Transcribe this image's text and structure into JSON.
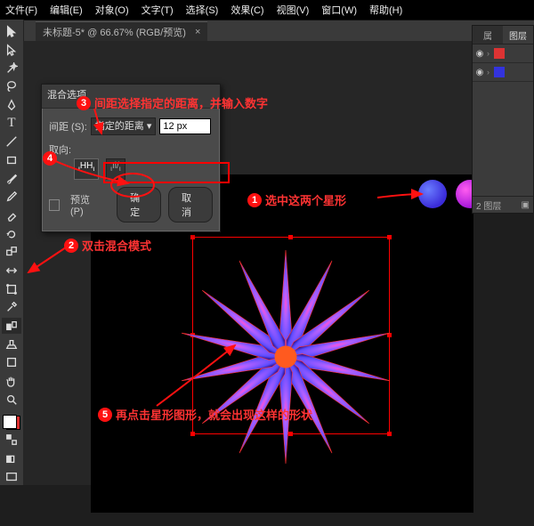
{
  "menu": [
    "文件(F)",
    "编辑(E)",
    "对象(O)",
    "文字(T)",
    "选择(S)",
    "效果(C)",
    "视图(V)",
    "窗口(W)",
    "帮助(H)"
  ],
  "tab": {
    "title": "未标题-5* @ 66.67% (RGB/预览)",
    "close": "×"
  },
  "dialog": {
    "title": "混合选项",
    "spacing_label": "间距 (S):",
    "spacing_mode": "指定的距离",
    "spacing_value": "12 px",
    "orient_label": "取向:",
    "preview": "预览 (P)",
    "ok": "确定",
    "cancel": "取消"
  },
  "annotations": {
    "a1": "选中这两个星形",
    "a2": "双击混合模式",
    "a3": "间距选择指定的距离，并输入数字",
    "a4": "",
    "a5": "再点击星形图形，就会出现这样的形状"
  },
  "layers": {
    "tab1": "属",
    "tab2": "图层",
    "footer": "2 图层"
  }
}
